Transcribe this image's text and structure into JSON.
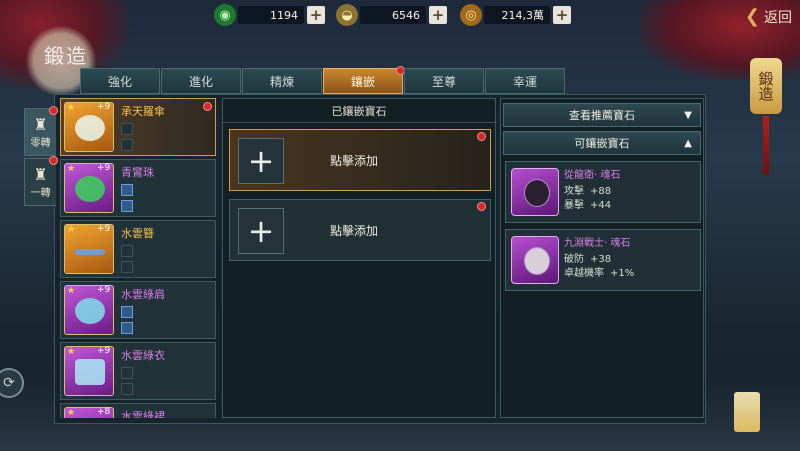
{
  "header": {
    "title": "鍛造",
    "back_label": "返回"
  },
  "currencies": [
    {
      "name": "jade",
      "icon": "jade-coin-icon",
      "value": "1194",
      "color": "#3fbf52"
    },
    {
      "name": "silver",
      "icon": "silver-ingot-icon",
      "value": "6546",
      "color": "#d8c070"
    },
    {
      "name": "copper",
      "icon": "copper-coin-icon",
      "value": "214,3萬",
      "color": "#e0a030"
    }
  ],
  "tabs": [
    {
      "label": "強化",
      "active": false
    },
    {
      "label": "進化",
      "active": false
    },
    {
      "label": "精煉",
      "active": false
    },
    {
      "label": "鑲嵌",
      "active": true
    },
    {
      "label": "至尊",
      "active": false
    },
    {
      "label": "幸運",
      "active": false
    }
  ],
  "side_tabs": [
    {
      "label": "零轉",
      "active": true
    },
    {
      "label": "一轉",
      "active": false
    }
  ],
  "items": [
    {
      "name": "承天羅傘",
      "level": "+9",
      "quality": "orange"
    },
    {
      "name": "青鸞珠",
      "level": "+9",
      "quality": "purple"
    },
    {
      "name": "水雲簪",
      "level": "+9",
      "quality": "orange"
    },
    {
      "name": "水雲綠肩",
      "level": "+9",
      "quality": "purple"
    },
    {
      "name": "水雲綠衣",
      "level": "+9",
      "quality": "purple"
    },
    {
      "name": "水雲綠裙",
      "level": "+8",
      "quality": "purple"
    }
  ],
  "middle": {
    "header": "已鑲嵌寶石",
    "sockets": [
      {
        "label": "點擊添加"
      },
      {
        "label": "點擊添加"
      }
    ]
  },
  "right": {
    "recommend_header": "查看推薦寶石",
    "available_header": "可鑲嵌寶石",
    "gems": [
      {
        "name": "從龍衛· 魂石",
        "stats": [
          {
            "label": "攻擊",
            "value": "+88"
          },
          {
            "label": "暴擊",
            "value": "+44"
          }
        ]
      },
      {
        "name": "九淵戰士· 魂石",
        "stats": [
          {
            "label": "破防",
            "value": "+38"
          },
          {
            "label": "卓越機率",
            "value": "+1%"
          }
        ]
      }
    ]
  },
  "side_button": {
    "label": "鍛造"
  },
  "colors": {
    "accent_gold": "#d79a45",
    "tab_active": "#c9882e",
    "gem_purple": "#d67fe6",
    "notify_red": "#d42a2a"
  }
}
